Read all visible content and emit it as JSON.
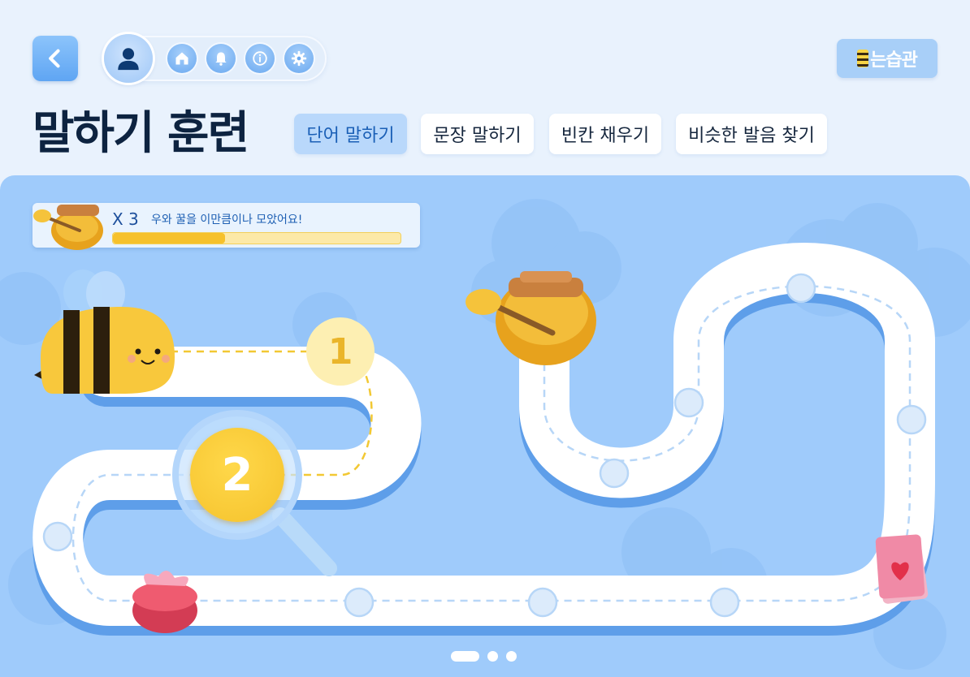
{
  "header": {
    "back_icon": "chevron-left-icon",
    "nav_icons": [
      "user-icon",
      "home-icon",
      "bell-icon",
      "info-icon",
      "gear-icon"
    ],
    "brand": "는습관"
  },
  "page_title": "말하기 훈련",
  "tabs": [
    {
      "label": "단어 말하기",
      "active": true
    },
    {
      "label": "문장 말하기",
      "active": false
    },
    {
      "label": "빈칸 채우기",
      "active": false
    },
    {
      "label": "비슷한 발음 찾기",
      "active": false
    }
  ],
  "honey_status": {
    "count": "X 3",
    "message": "우와 꿀을 이만큼이나 모았어요!",
    "progress": 0.39
  },
  "stages": [
    {
      "label": "1",
      "state": "completed"
    },
    {
      "label": "2",
      "state": "current"
    }
  ],
  "pagination": {
    "pages": 3,
    "current": 1
  },
  "colors": {
    "accent": "#5fa5f3",
    "honey": "#f6c12c",
    "board": "#9fcbfb",
    "title": "#0d2340"
  }
}
